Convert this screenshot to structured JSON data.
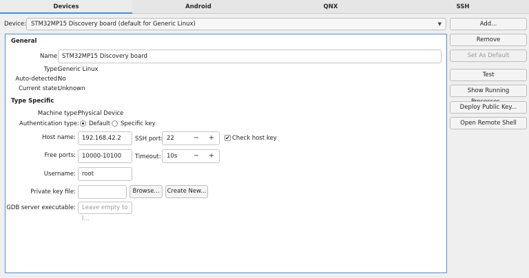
{
  "tabs": [
    {
      "label": "Devices"
    },
    {
      "label": "Android"
    },
    {
      "label": "QNX"
    },
    {
      "label": "SSH"
    }
  ],
  "device": {
    "label": "Device:",
    "selected": "STM32MP15 Discovery board (default for Generic Linux)"
  },
  "side_buttons": {
    "add": "Add...",
    "remove": "Remove",
    "set_default": "Set As Default",
    "test": "Test",
    "show_processes": "Show Running Processes...",
    "deploy_key": "Deploy Public Key...",
    "open_shell": "Open Remote Shell"
  },
  "general": {
    "title": "General",
    "name_label": "Name:",
    "name_value": "STM32MP15 Discovery board",
    "type_label": "Type:",
    "type_value": "Generic Linux",
    "auto_label": "Auto-detected:",
    "auto_value": "No",
    "state_label": "Current state:",
    "state_value": "Unknown"
  },
  "type_specific": {
    "title": "Type Specific",
    "machine_label": "Machine type:",
    "machine_value": "Physical Device",
    "auth_label": "Authentication type:",
    "auth_default": "Default",
    "auth_specific": "Specific key",
    "auth_selected": "Default",
    "host_label": "Host name:",
    "host_value": "192.168.42.2",
    "ssh_port_label": "SSH port:",
    "ssh_port_value": "22",
    "check_host_key_label": "Check host key",
    "check_host_key": true,
    "free_ports_label": "Free ports:",
    "free_ports_value": "10000-10100",
    "timeout_label": "Timeout:",
    "timeout_value": "10s",
    "username_label": "Username:",
    "username_value": "root",
    "private_key_label": "Private key file:",
    "private_key_value": "",
    "browse_label": "Browse...",
    "create_new_label": "Create New...",
    "gdb_label": "GDB server executable:",
    "gdb_placeholder": "Leave empty to l..."
  },
  "spin": {
    "minus": "−",
    "plus": "+"
  }
}
